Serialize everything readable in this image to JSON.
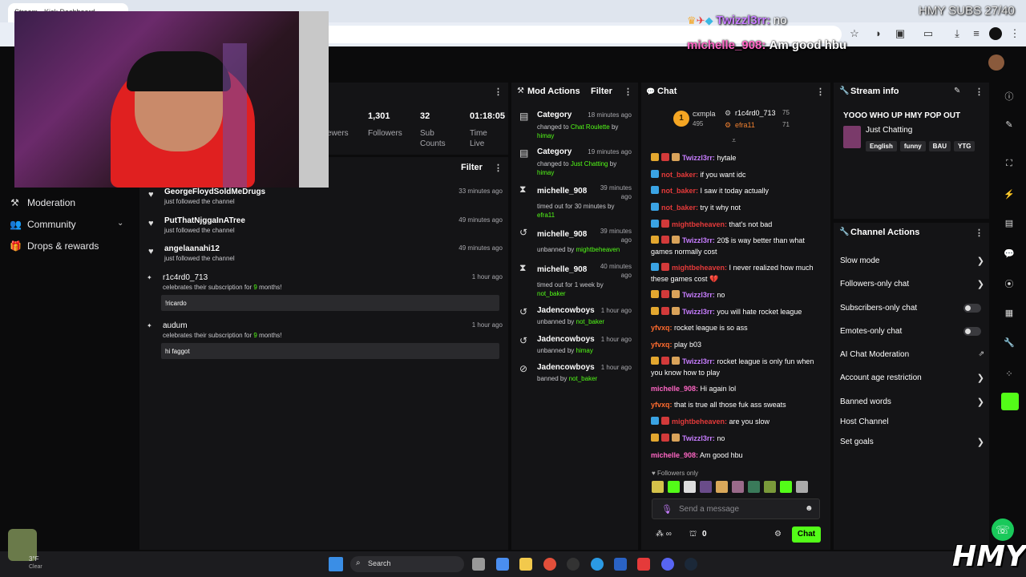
{
  "browser": {
    "tab_title": "Stream - Kick Dashboard"
  },
  "overlay": {
    "subs_goal": "HMY SUBS 27/40",
    "chat1_user": "Twizzl3rr:",
    "chat1_msg": "no",
    "chat2_user": "michelle_908:",
    "chat2_msg": "Am good hbu",
    "logo": "HMY"
  },
  "nav": {
    "moderation": "Moderation",
    "community": "Community",
    "drops": "Drops & rewards"
  },
  "stats": {
    "viewers_label": "ewers",
    "followers_value": "1,301",
    "followers_label": "Followers",
    "subs_value": "32",
    "subs_label1": "Sub",
    "subs_label2": "Counts",
    "time_value": "01:18:05",
    "time_label1": "Time",
    "time_label2": "Live"
  },
  "feed": {
    "filter": "Filter",
    "items": [
      {
        "name": "GeorgeFloydSoldMeDrugs",
        "sub": "just followed the channel",
        "time": "33 minutes ago"
      },
      {
        "name": "PutThatNjggaInATree",
        "sub": "just followed the channel",
        "time": "49 minutes ago"
      },
      {
        "name": "angelaanahi12",
        "sub": "just followed the channel",
        "time": "49 minutes ago"
      },
      {
        "name": "r1c4rd0_713",
        "sub_pre": "celebrates their subscription for ",
        "sub_num": "9",
        "sub_post": " months!",
        "time": "1 hour ago",
        "msg": "!ricardo"
      },
      {
        "name": "audum",
        "sub_pre": "celebrates their subscription for ",
        "sub_num": "9",
        "sub_post": " months!",
        "time": "1 hour ago",
        "msg": "hi faggot"
      }
    ]
  },
  "mod": {
    "title": "Mod Actions",
    "filter": "Filter",
    "items": [
      {
        "name": "Category",
        "time": "18 minutes ago",
        "l1": "changed to ",
        "l1g": "Chat Roulette",
        "l1b": " by",
        "l2g": "himay"
      },
      {
        "name": "Category",
        "time": "19 minutes ago",
        "l1": "changed to ",
        "l1g": "Just Chatting",
        "l1b": " by",
        "l2g": "himay"
      },
      {
        "name": "michelle_908",
        "time1": "39 minutes",
        "time2": "ago",
        "l1": "timed out for 30 minutes by",
        "l2g": "efra11"
      },
      {
        "name": "michelle_908",
        "time1": "39 minutes",
        "time2": "ago",
        "l1": "unbanned by ",
        "l1g": "mightbeheaven"
      },
      {
        "name": "michelle_908",
        "time1": "40 minutes",
        "time2": "ago",
        "l1": "timed out for 1 week by",
        "l2g": "not_baker"
      },
      {
        "name": "Jadencowboys",
        "time": "1 hour ago",
        "l1": "unbanned by ",
        "l1g": "not_baker"
      },
      {
        "name": "Jadencowboys",
        "time": "1 hour ago",
        "l1": "unbanned by ",
        "l1g": "himay"
      },
      {
        "name": "Jadencowboys",
        "time": "1 hour ago",
        "l1": "banned by ",
        "l1g": "not_baker"
      }
    ]
  },
  "chat": {
    "title": "Chat",
    "leader1_name": "cxmpla",
    "leader1_val": "495",
    "leader2_name": "r1c4rd0_713",
    "leader2_val": "75",
    "leader3_name": "efra11",
    "leader3_val": "71",
    "rank": "1",
    "lines": [
      {
        "user": "Twizzl3rr:",
        "msg": " hytale"
      },
      {
        "user": "not_baker:",
        "msg": " if you want idc"
      },
      {
        "user": "not_baker:",
        "msg": " I saw it today actually"
      },
      {
        "user": "not_baker:",
        "msg": " try it why not"
      },
      {
        "user": "mightbeheaven:",
        "msg": " that's not bad"
      },
      {
        "user": "Twizzl3rr:",
        "msg": " 20$ is way better than what games normally cost"
      },
      {
        "user": "mightbeheaven:",
        "msg": " I never realized how much these games cost 💔"
      },
      {
        "user": "Twizzl3rr:",
        "msg": " no"
      },
      {
        "user": "Twizzl3rr:",
        "msg": " you will hate rocket league"
      },
      {
        "user": "yfvxq:",
        "msg": " rocket league is so ass"
      },
      {
        "user": "yfvxq:",
        "msg": " play b03"
      },
      {
        "user": "Twizzl3rr:",
        "msg": " rocket league is only fun when you know how to play"
      },
      {
        "user": "michelle_908:",
        "msg": " Hi again lol"
      },
      {
        "user": "yfvxq:",
        "msg": " that is true all those fuk ass sweats"
      },
      {
        "user": "mightbeheaven:",
        "msg": " are you slow"
      },
      {
        "user": "Twizzl3rr:",
        "msg": " no"
      },
      {
        "user": "michelle_908:",
        "msg": " Am good hbu"
      }
    ],
    "followers_only": "Followers only",
    "placeholder": "Send a message",
    "count": "0",
    "send": "Chat"
  },
  "stream_info": {
    "title": "Stream info",
    "stream_title": "YOOO WHO UP HMY POP OUT",
    "category": "Just Chatting",
    "tags": [
      "English",
      "funny",
      "BAU",
      "YTG"
    ]
  },
  "channel_actions": {
    "title": "Channel Actions",
    "items": [
      "Slow mode",
      "Followers-only chat",
      "Subscribers-only chat",
      "Emotes-only chat",
      "AI Chat Moderation",
      "Account age restriction",
      "Banned words",
      "Host Channel",
      "Set goals"
    ]
  },
  "taskbar": {
    "search": "Search"
  },
  "weather": {
    "temp": "3°F",
    "cond": "Clear"
  },
  "colors": {
    "accent": "#53fc18",
    "panel": "#141416",
    "bg": "#0b0b0c"
  }
}
